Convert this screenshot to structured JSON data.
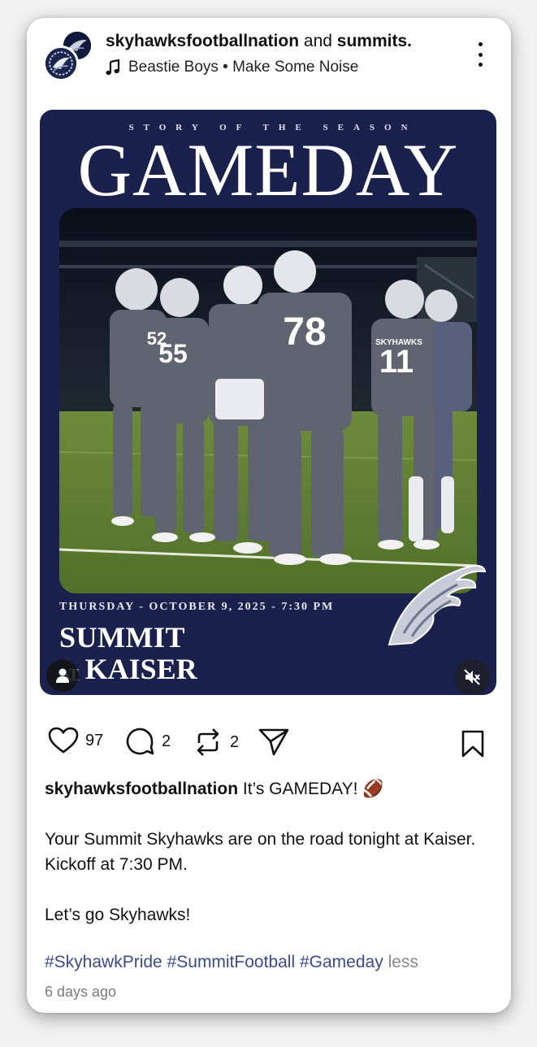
{
  "header": {
    "account1": "skyhawksfootballnation",
    "joiner": "and",
    "account2": "summits.",
    "music": "Beastie Boys • Make Some Noise"
  },
  "poster": {
    "kicker": "STORY OF THE SEASON",
    "headline": "GAMEDAY",
    "jersey_numbers": [
      "52",
      "55",
      "78",
      "11"
    ],
    "jersey_text": "SKYHAWKS",
    "date_line": "THURSDAY - OCTOBER 9, 2025 - 7:30 PM",
    "team_home": "SUMMIT",
    "at": "AT",
    "team_away": "KAISER"
  },
  "actions": {
    "likes": "97",
    "comments": "2",
    "reposts": "2"
  },
  "caption": {
    "username": "skyhawksfootballnation",
    "first_line": " It’s GAMEDAY! 🏈",
    "line2": "Your Summit Skyhawks are on the road tonight at Kaiser. Kickoff at 7:30 PM.",
    "line3": "Let’s go Skyhawks!",
    "hashtags": [
      "#SkyhawkPride",
      "#SummitFootball",
      "#Gameday"
    ],
    "less": "less",
    "timestamp": "6 days ago"
  },
  "colors": {
    "poster_navy": "#1b214d",
    "hashtag_blue": "#3a4a8f",
    "uniform_gray": "#5f6470"
  },
  "icons": [
    "music-note-icon",
    "more-options-icon",
    "heart-icon",
    "comment-icon",
    "repost-icon",
    "share-icon",
    "bookmark-icon",
    "user-tag-icon",
    "muted-speaker-icon",
    "skyhawk-logo"
  ]
}
